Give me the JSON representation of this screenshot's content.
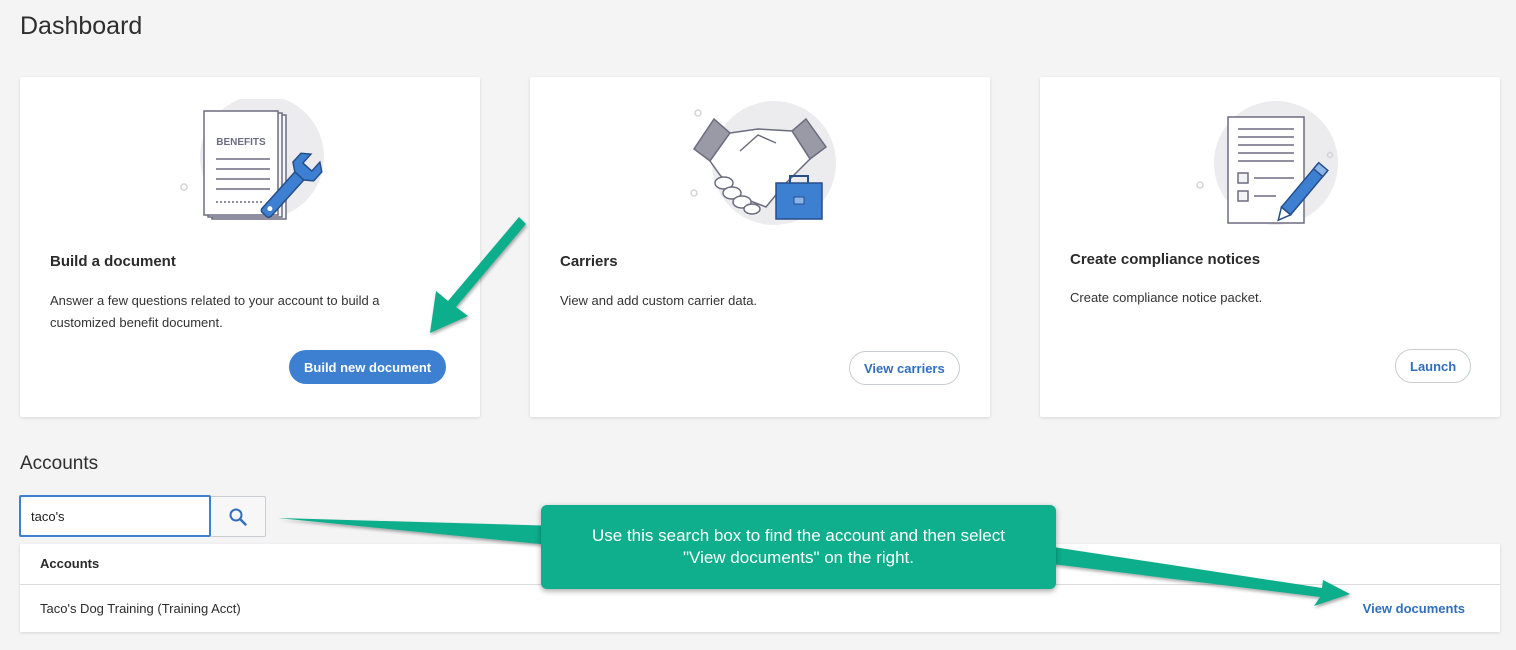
{
  "page": {
    "title": "Dashboard"
  },
  "cards": [
    {
      "illustration": "benefits-document-wrench-icon",
      "illustration_label": "BENEFITS",
      "title": "Build a document",
      "description": "Answer a few questions related to your account to build a customized benefit document.",
      "button_label": "Build new document"
    },
    {
      "illustration": "handshake-briefcase-icon",
      "title": "Carriers",
      "description": "View and add custom carrier data.",
      "button_label": "View carriers"
    },
    {
      "illustration": "checklist-pencil-icon",
      "title": "Create compliance notices",
      "description": "Create compliance notice packet.",
      "button_label": "Launch"
    }
  ],
  "accounts": {
    "section_title": "Accounts",
    "search": {
      "value": "taco's",
      "placeholder": ""
    },
    "table": {
      "header": "Accounts",
      "rows": [
        {
          "name": "Taco's Dog Training (Training Acct)",
          "action": "View documents"
        }
      ]
    }
  },
  "annotation": {
    "callout_text": "Use this search box to find the account and then select \"View documents\" on the right."
  },
  "colors": {
    "primary": "#3d7fd1",
    "link": "#2f6fbf",
    "callout": "#0fae8c",
    "background": "#f4f4f4"
  }
}
